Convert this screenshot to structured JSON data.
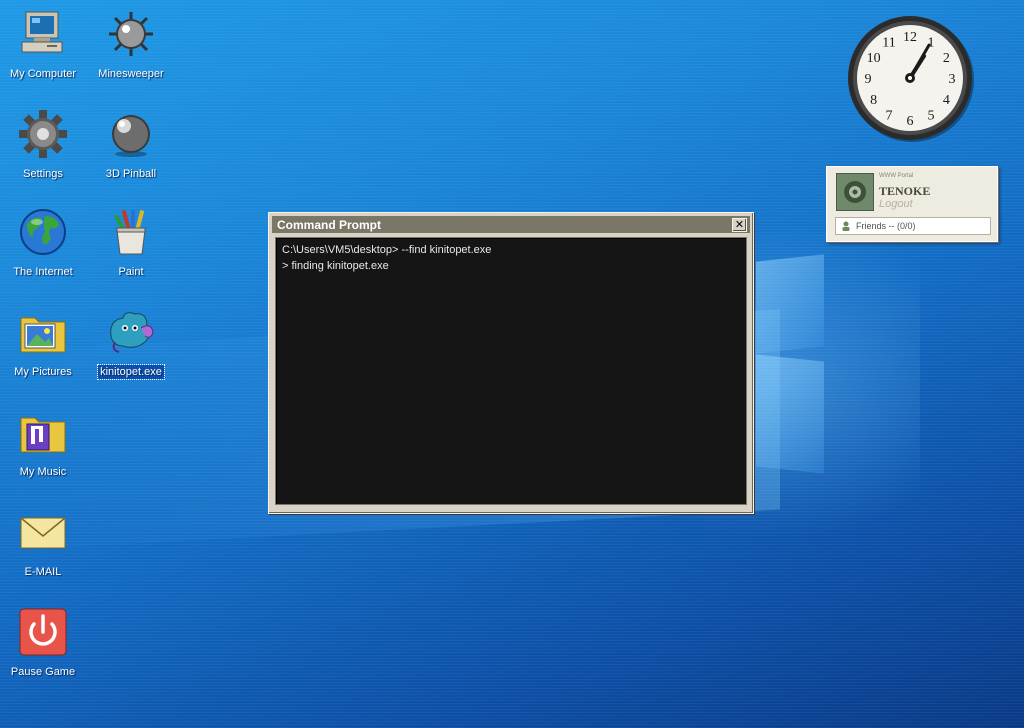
{
  "desktop": {
    "icons": [
      {
        "label": "My Computer",
        "icon": "computer-icon"
      },
      {
        "label": "Minesweeper",
        "icon": "mine-icon"
      },
      {
        "label": "Settings",
        "icon": "gear-icon"
      },
      {
        "label": "3D Pinball",
        "icon": "pinball-icon"
      },
      {
        "label": "The Internet",
        "icon": "globe-icon"
      },
      {
        "label": "Paint",
        "icon": "paint-icon"
      },
      {
        "label": "My Pictures",
        "icon": "pictures-folder-icon"
      },
      {
        "label": "kinitopet.exe",
        "icon": "kinitopet-icon",
        "selected": true
      },
      {
        "label": "My Music",
        "icon": "music-folder-icon"
      },
      {
        "label": "E-MAIL",
        "icon": "envelope-icon"
      },
      {
        "label": "Pause Game",
        "icon": "power-icon"
      }
    ]
  },
  "cmd": {
    "title": "Command Prompt",
    "close_glyph": "✕",
    "lines": [
      "C:\\Users\\VM5\\desktop> --find kinitopet.exe",
      "> finding kinitopet.exe"
    ]
  },
  "clock": {
    "numerals": [
      "12",
      "1",
      "2",
      "3",
      "4",
      "5",
      "6",
      "7",
      "8",
      "9",
      "10",
      "11"
    ],
    "time": {
      "hour": 1,
      "minute": 5
    }
  },
  "messenger": {
    "caption": "WWW Portal",
    "username": "TENOKE",
    "logout": "Logout",
    "friends": "Friends -- (0/0)"
  },
  "colors": {
    "desktop_top": "#1f9ae6",
    "desktop_bottom": "#0a3a86",
    "window_face": "#d8d3c6",
    "titlebar": "#7b7766",
    "console_bg": "#151515",
    "console_text": "#e8e8e8"
  }
}
